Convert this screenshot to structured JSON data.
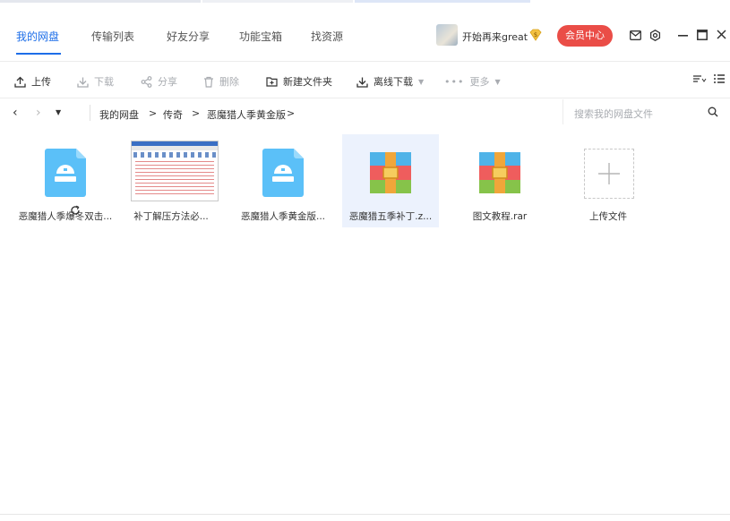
{
  "colors": {
    "accent": "#1d6ee8",
    "member": "#ea4d47",
    "selected_bg": "#ecf2fd",
    "doc_icon": "#5bc0f8"
  },
  "header": {
    "tabs": [
      "我的网盘",
      "传输列表",
      "好友分享",
      "功能宝箱",
      "找资源"
    ],
    "active_tab": 0,
    "username": "开始再来great",
    "member_button": "会员中心"
  },
  "toolbar": {
    "upload": "上传",
    "download": "下载",
    "share": "分享",
    "delete": "删除",
    "new_folder": "新建文件夹",
    "offline_download": "离线下载",
    "more": "更多"
  },
  "path": {
    "items": [
      "我的网盘",
      "传奇",
      "恶魔猎人季黄金版"
    ],
    "separator": ">",
    "search_placeholder": "搜索我的网盘文件"
  },
  "files": [
    {
      "name": "恶魔猎人季爆冬双击...",
      "icon": "doc-icon",
      "selected": false
    },
    {
      "name": "补丁解压方法必...",
      "icon": "image-thumbnail",
      "selected": false
    },
    {
      "name": "恶魔猎人季黄金版...",
      "icon": "doc-icon",
      "selected": false
    },
    {
      "name": "恶魔猎五季补丁.z...",
      "icon": "archive-icon",
      "selected": true
    },
    {
      "name": "图文教程.rar",
      "icon": "archive-icon",
      "selected": false
    },
    {
      "name": "上传文件",
      "icon": "plus-icon",
      "selected": false
    }
  ]
}
